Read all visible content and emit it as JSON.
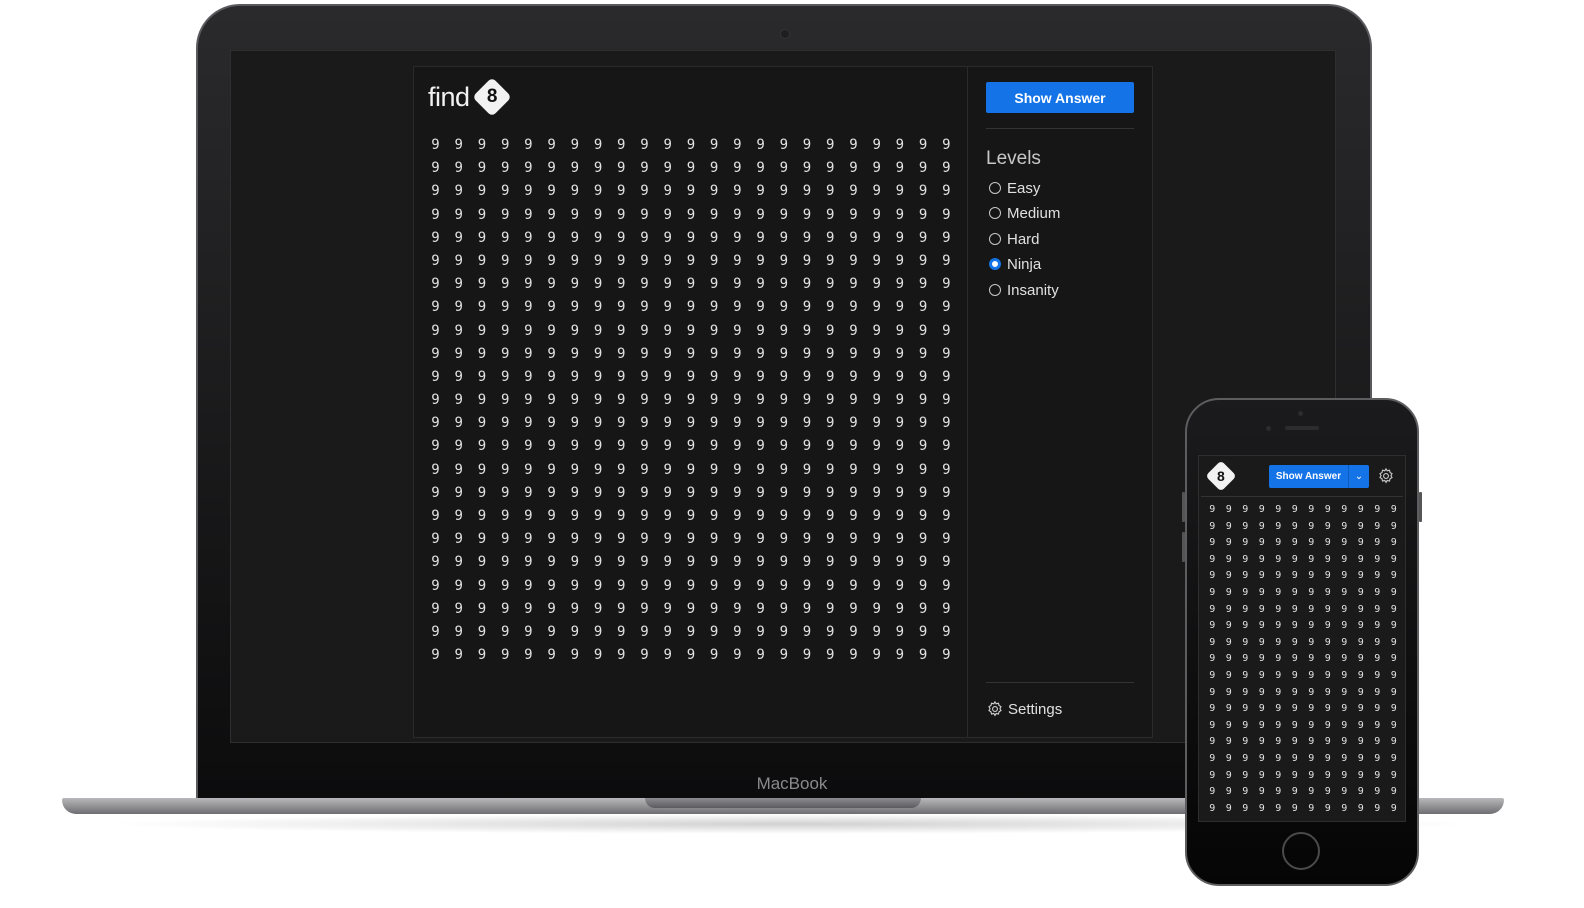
{
  "device_label": "MacBook",
  "app": {
    "logo_text": "find",
    "logo_badge": "8",
    "show_answer_label": "Show Answer",
    "levels_title": "Levels",
    "levels": [
      {
        "label": "Easy",
        "selected": false
      },
      {
        "label": "Medium",
        "selected": false
      },
      {
        "label": "Hard",
        "selected": false
      },
      {
        "label": "Ninja",
        "selected": true
      },
      {
        "label": "Insanity",
        "selected": false
      }
    ],
    "settings_label": "Settings",
    "grid": {
      "rows": 23,
      "cols": 23,
      "digit": "9"
    }
  },
  "phone_app": {
    "logo_badge": "8",
    "show_answer_label": "Show Answer",
    "dropdown_icon": "chevron-down-icon",
    "grid": {
      "rows": 19,
      "cols": 12,
      "digit": "9"
    }
  },
  "colors": {
    "accent": "#1473e6",
    "background": "#161616",
    "text": "#e2e2e2"
  }
}
